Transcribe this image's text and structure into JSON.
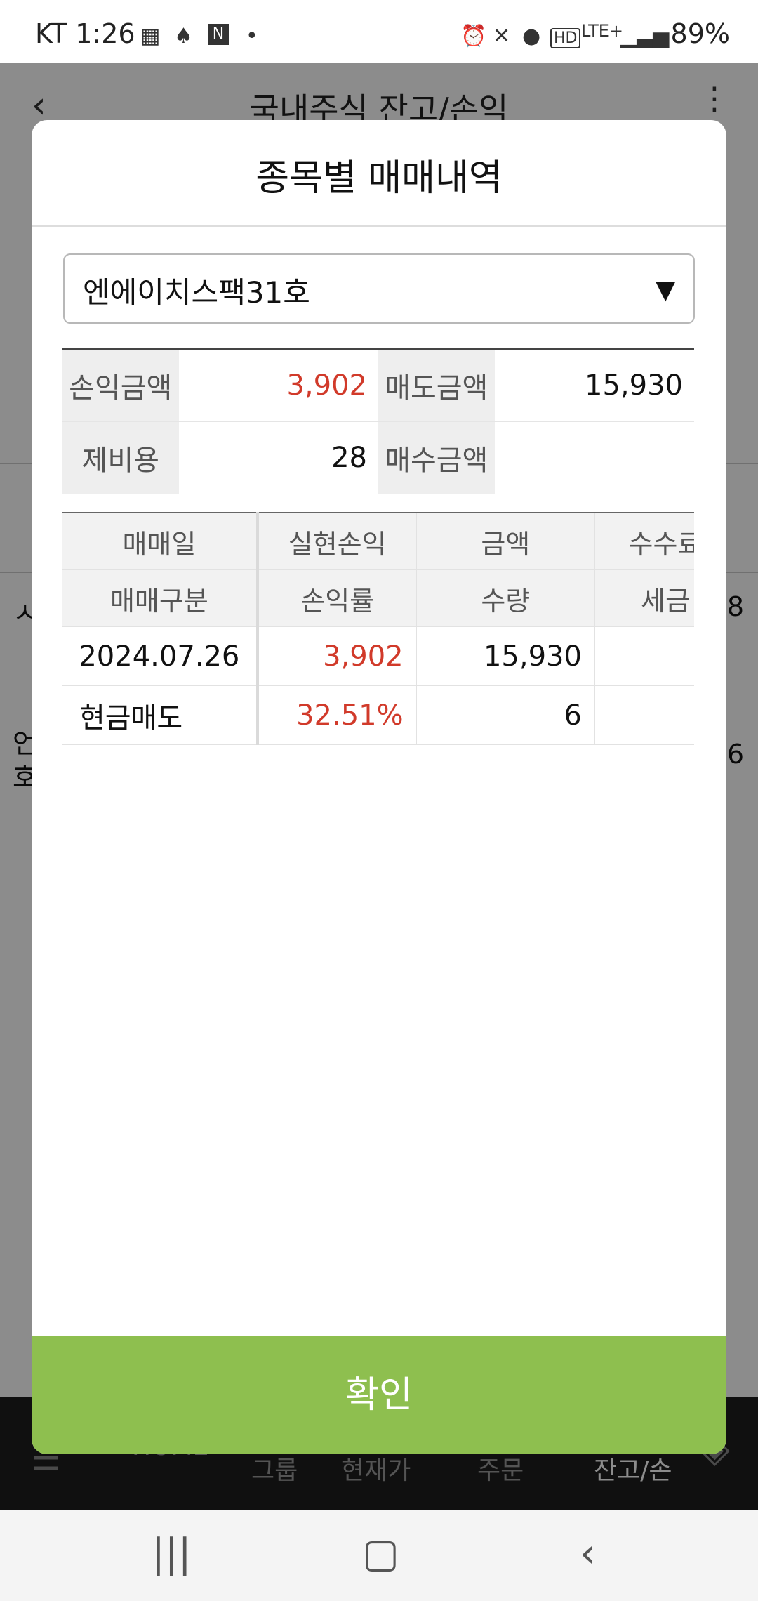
{
  "status_bar": {
    "carrier_time": "KT 1:26",
    "network": "LTE+",
    "battery": "89%",
    "icons": [
      "calendar-icon",
      "notification-icon",
      "naver-icon",
      "dot-icon",
      "alarm-icon",
      "mute-icon",
      "location-icon",
      "hd-icon",
      "signal-icon",
      "battery-icon"
    ]
  },
  "background": {
    "title": "국내주식 잔고/손익",
    "row1_left": "ㅅ",
    "row1_right": "8",
    "row2_left_1": "언",
    "row2_left_2": "호",
    "row2_right": "6",
    "nav": [
      "HOME",
      "그룹",
      "현재가",
      "주문",
      "잔고/손"
    ]
  },
  "modal": {
    "title": "종목별 매매내역",
    "stock_select": {
      "value": "엔에이치스팩31호"
    },
    "summary": {
      "pl_amount_label": "손익금액",
      "pl_amount_value": "3,902",
      "sell_amount_label": "매도금액",
      "sell_amount_value": "15,930",
      "fees_label": "제비용",
      "fees_value": "28",
      "buy_amount_label": "매수금액",
      "buy_amount_value": ""
    },
    "grid": {
      "header_row1": [
        "매매일",
        "실현손익",
        "금액",
        "수수료"
      ],
      "header_row2": [
        "매매구분",
        "손익률",
        "수량",
        "세금"
      ],
      "trade": {
        "date": "2024.07.26",
        "realized_pl": "3,902",
        "amount": "15,930",
        "commission": "",
        "trade_type": "현금매도",
        "pl_rate": "32.51%",
        "quantity": "6",
        "tax": ""
      }
    },
    "confirm_label": "확인"
  },
  "colors": {
    "accent_green": "#8ebf4f",
    "loss_profit_red": "#d13a2a"
  }
}
